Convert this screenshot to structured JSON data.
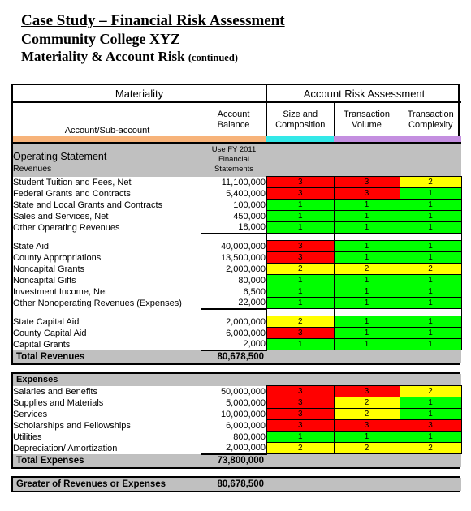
{
  "titles": {
    "main": "Case Study – Financial Risk Assessment",
    "sub": "Community College XYZ",
    "third": "Materiality & Account Risk",
    "third_note": "(continued)"
  },
  "colors": {
    "accent_materiality": "#f7b37a",
    "accent_size": "#33e8e8",
    "accent_volume": "#c48fe0",
    "accent_complexity": "#c48fe0",
    "risk_low": "#00ff00",
    "risk_medium": "#ffff00",
    "risk_high": "#ff0000",
    "band_gray": "#c0c0c0"
  },
  "header": {
    "group_materiality": "Materiality",
    "group_risk": "Account Risk Assessment",
    "col_account": "Account/Sub-account",
    "col_balance_l1": "Account",
    "col_balance_l2": "Balance",
    "col_size_l1": "Size and",
    "col_size_l2": "Composition",
    "col_volume_l1": "Transaction",
    "col_volume_l2": "Volume",
    "col_complexity_l1": "Transaction",
    "col_complexity_l2": "Complexity"
  },
  "operating": {
    "section_title": "Operating Statement",
    "section_sub": "Revenues",
    "note_l1": "Use FY 2011",
    "note_l2": "Financial",
    "note_l3": "Statements"
  },
  "expenses_header": {
    "label": "Expenses"
  },
  "revenue_group_1": [
    {
      "account": "Student Tuition and Fees, Net",
      "balance": "11,100,000",
      "size": "3",
      "volume": "3",
      "complexity": "2",
      "size_risk": "r",
      "volume_risk": "r",
      "complexity_risk": "y"
    },
    {
      "account": "Federal Grants and Contracts",
      "balance": "5,400,000",
      "size": "3",
      "volume": "3",
      "complexity": "1",
      "size_risk": "r",
      "volume_risk": "r",
      "complexity_risk": "g"
    },
    {
      "account": "State and Local Grants and Contracts",
      "balance": "100,000",
      "size": "1",
      "volume": "1",
      "complexity": "1",
      "size_risk": "g",
      "volume_risk": "g",
      "complexity_risk": "g"
    },
    {
      "account": "Sales and Services, Net",
      "balance": "450,000",
      "size": "1",
      "volume": "1",
      "complexity": "1",
      "size_risk": "g",
      "volume_risk": "g",
      "complexity_risk": "g"
    },
    {
      "account": "Other Operating Revenues",
      "balance": "18,000",
      "size": "1",
      "volume": "1",
      "complexity": "1",
      "size_risk": "g",
      "volume_risk": "g",
      "complexity_risk": "g"
    }
  ],
  "revenue_group_2": [
    {
      "account": "State Aid",
      "balance": "40,000,000",
      "size": "3",
      "volume": "1",
      "complexity": "1",
      "size_risk": "r",
      "volume_risk": "g",
      "complexity_risk": "g"
    },
    {
      "account": "County Appropriations",
      "balance": "13,500,000",
      "size": "3",
      "volume": "1",
      "complexity": "1",
      "size_risk": "r",
      "volume_risk": "g",
      "complexity_risk": "g"
    },
    {
      "account": "Noncapital Grants",
      "balance": "2,000,000",
      "size": "2",
      "volume": "2",
      "complexity": "2",
      "size_risk": "y",
      "volume_risk": "y",
      "complexity_risk": "y"
    },
    {
      "account": "Noncapital Gifts",
      "balance": "80,000",
      "size": "1",
      "volume": "1",
      "complexity": "1",
      "size_risk": "g",
      "volume_risk": "g",
      "complexity_risk": "g"
    },
    {
      "account": "Investment Income, Net",
      "balance": "6,500",
      "size": "1",
      "volume": "1",
      "complexity": "1",
      "size_risk": "g",
      "volume_risk": "g",
      "complexity_risk": "g"
    },
    {
      "account": "Other Nonoperating Revenues (Expenses)",
      "balance": "22,000",
      "size": "1",
      "volume": "1",
      "complexity": "1",
      "size_risk": "g",
      "volume_risk": "g",
      "complexity_risk": "g"
    }
  ],
  "revenue_group_3": [
    {
      "account": "State Capital Aid",
      "balance": "2,000,000",
      "size": "2",
      "volume": "1",
      "complexity": "1",
      "size_risk": "y",
      "volume_risk": "g",
      "complexity_risk": "g"
    },
    {
      "account": "County Capital Aid",
      "balance": "6,000,000",
      "size": "3",
      "volume": "1",
      "complexity": "1",
      "size_risk": "r",
      "volume_risk": "g",
      "complexity_risk": "g"
    },
    {
      "account": "Capital Grants",
      "balance": "2,000",
      "size": "1",
      "volume": "1",
      "complexity": "1",
      "size_risk": "g",
      "volume_risk": "g",
      "complexity_risk": "g"
    }
  ],
  "total_revenues": {
    "label": "Total Revenues",
    "value": "80,678,500"
  },
  "expense_rows": [
    {
      "account": "Salaries and Benefits",
      "balance": "50,000,000",
      "size": "3",
      "volume": "3",
      "complexity": "2",
      "size_risk": "r",
      "volume_risk": "r",
      "complexity_risk": "y"
    },
    {
      "account": "Supplies and Materials",
      "balance": "5,000,000",
      "size": "3",
      "volume": "2",
      "complexity": "1",
      "size_risk": "r",
      "volume_risk": "y",
      "complexity_risk": "g"
    },
    {
      "account": "Services",
      "balance": "10,000,000",
      "size": "3",
      "volume": "2",
      "complexity": "1",
      "size_risk": "r",
      "volume_risk": "y",
      "complexity_risk": "g"
    },
    {
      "account": "Scholarships and Fellowships",
      "balance": "6,000,000",
      "size": "3",
      "volume": "3",
      "complexity": "3",
      "size_risk": "r",
      "volume_risk": "r",
      "complexity_risk": "r"
    },
    {
      "account": "Utilities",
      "balance": "800,000",
      "size": "1",
      "volume": "1",
      "complexity": "1",
      "size_risk": "g",
      "volume_risk": "g",
      "complexity_risk": "g"
    },
    {
      "account": "Depreciation/ Amortization",
      "balance": "2,000,000",
      "size": "2",
      "volume": "2",
      "complexity": "2",
      "size_risk": "y",
      "volume_risk": "y",
      "complexity_risk": "y"
    }
  ],
  "total_expenses": {
    "label": "Total Expenses",
    "value": "73,800,000"
  },
  "greater_of": {
    "label": "Greater of Revenues or Expenses",
    "value": "80,678,500"
  }
}
